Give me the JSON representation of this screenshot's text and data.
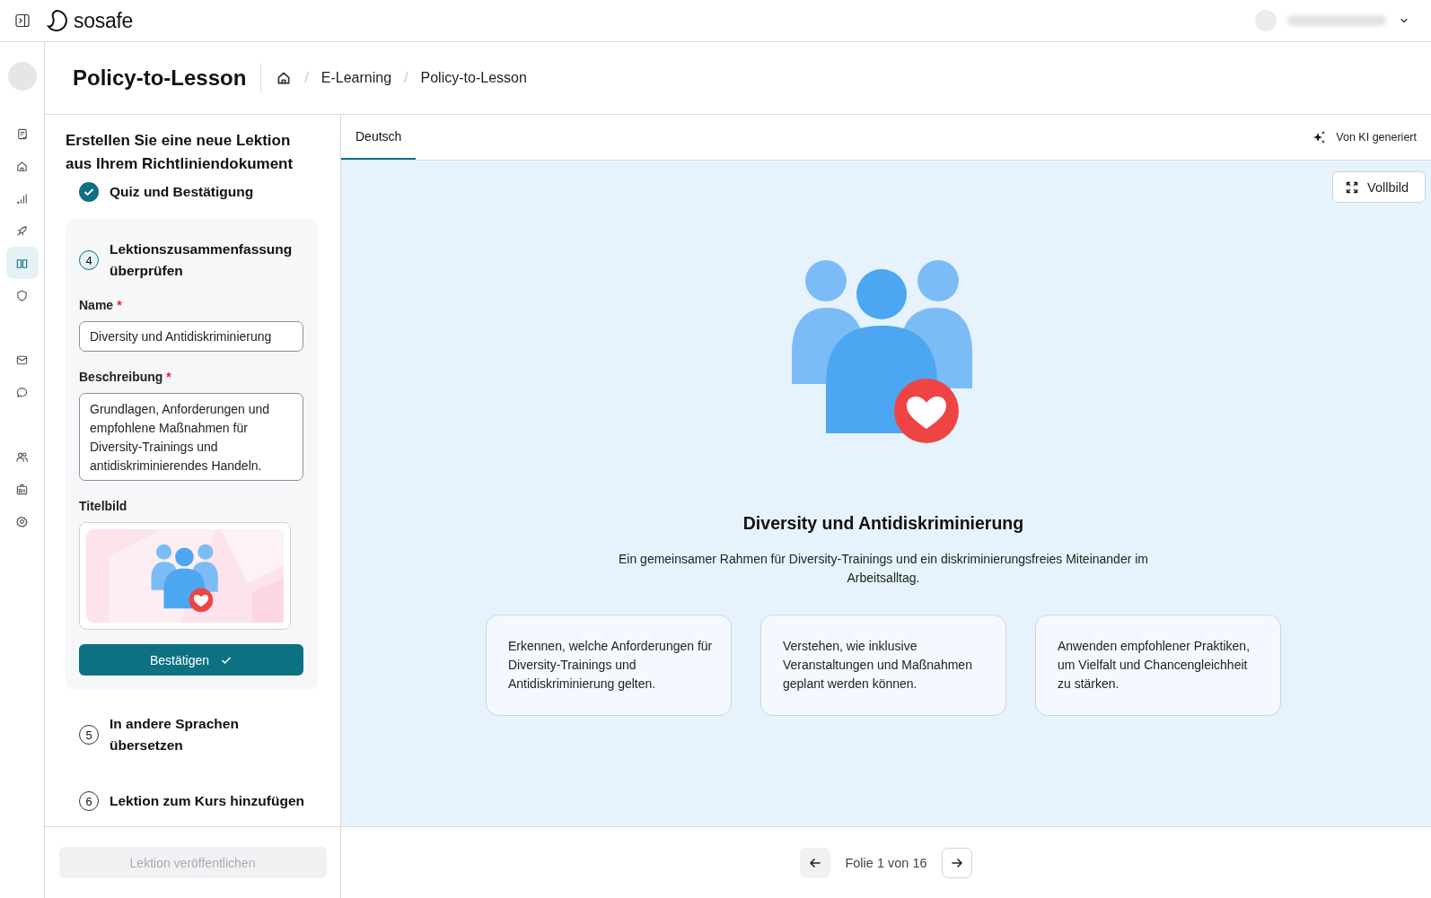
{
  "topbar": {
    "logo_text": "sosafe"
  },
  "page": {
    "title": "Policy-to-Lesson",
    "breadcrumb_separator": "/",
    "breadcrumbs": [
      "E-Learning",
      "Policy-to-Lesson"
    ]
  },
  "sidebar": {
    "groups": [
      {
        "items": [
          {
            "kind": "checklist",
            "selected": false
          },
          {
            "kind": "home",
            "selected": false
          },
          {
            "kind": "chart",
            "selected": false
          },
          {
            "kind": "rocket",
            "selected": false
          },
          {
            "kind": "book",
            "selected": true
          },
          {
            "kind": "shield",
            "selected": false
          }
        ]
      },
      {
        "items": [
          {
            "kind": "mail",
            "selected": false
          },
          {
            "kind": "chat",
            "selected": false
          }
        ]
      },
      {
        "items": [
          {
            "kind": "users",
            "selected": false
          },
          {
            "kind": "badge",
            "selected": false
          },
          {
            "kind": "gear",
            "selected": false
          }
        ]
      }
    ]
  },
  "wizard": {
    "heading": "Erstellen Sie eine neue Lektion aus Ihrem Richtliniendokument",
    "steps": [
      {
        "completed": true,
        "current": false,
        "title": "Quiz und Bestätigung"
      },
      {
        "completed": false,
        "current": true,
        "number": "4",
        "title": "Lektionszusammenfassung überprüfen"
      },
      {
        "completed": false,
        "current": false,
        "number": "5",
        "title": "In andere Sprachen übersetzen"
      },
      {
        "completed": false,
        "current": false,
        "number": "6",
        "title": "Lektion zum Kurs hinzufügen"
      }
    ],
    "form": {
      "name_label": "Name",
      "name_required_mark": "*",
      "name_value": "Diversity und Antidiskriminierung",
      "description_label": "Beschreibung",
      "description_required_mark": "*",
      "description_value": "Grundlagen, Anforderungen und empfohlene Maßnahmen für Diversity-Trainings und antidiskriminierendes Handeln.",
      "image_label": "Titelbild",
      "confirm_button": "Bestätigen"
    },
    "publish_button": {
      "label": "Lektion veröffentlichen",
      "disabled": true
    }
  },
  "preview": {
    "tabs": [
      {
        "label": "Deutsch",
        "selected": true
      }
    ],
    "ai_label": "Von KI generiert",
    "fullscreen_button": "Vollbild",
    "slide": {
      "title": "Diversity und Antidiskriminierung",
      "subtitle": "Ein gemeinsamer Rahmen für Diversity-Trainings und ein diskriminierungsfreies Miteinander im Arbeitsalltag.",
      "cards": [
        "Erkennen, welche Anforderungen für Diversity-Trainings und Antidiskriminierung gelten.",
        "Verstehen, wie inklusive Veranstaltungen und Maßnahmen geplant werden können.",
        "Anwenden empfohlener Praktiken, um Vielfalt und Chancengleichheit zu stärken."
      ]
    },
    "pager": {
      "text": "Folie 1 von 16",
      "prev_disabled": true
    }
  }
}
